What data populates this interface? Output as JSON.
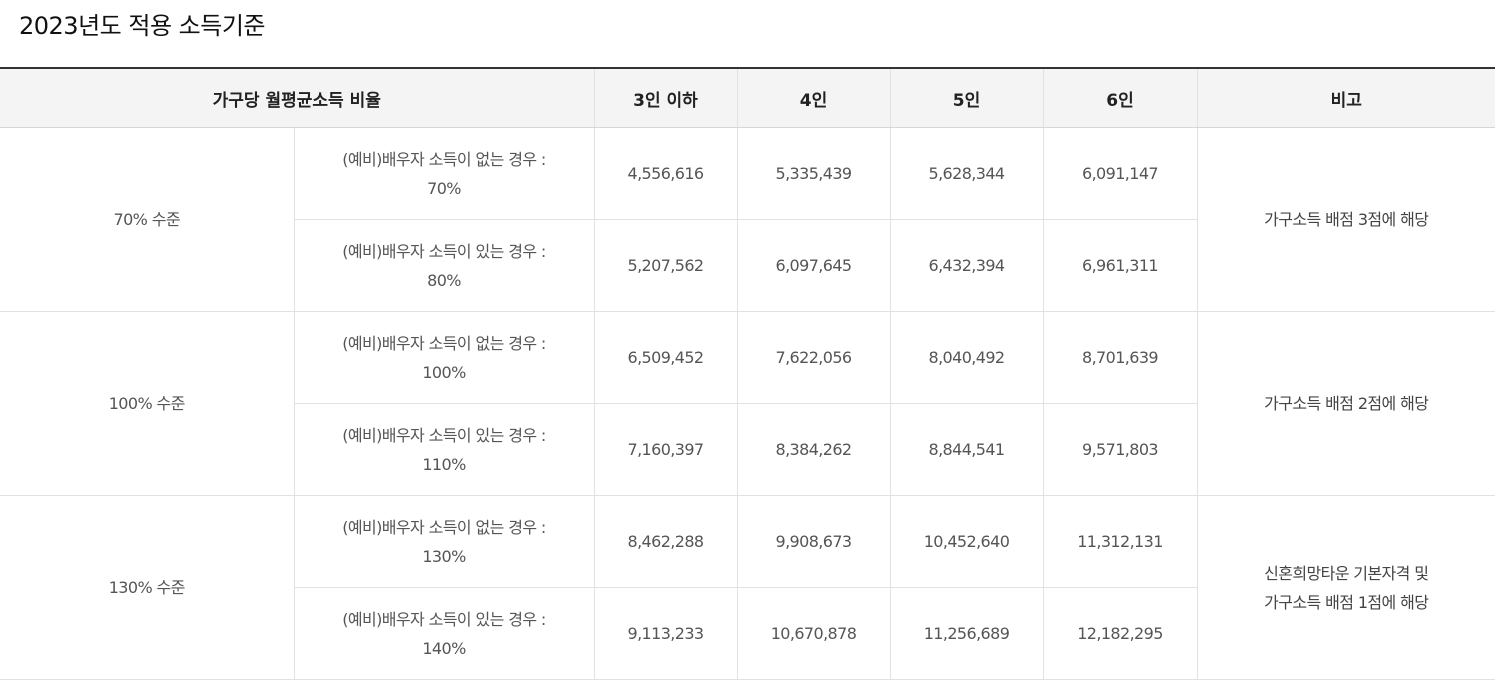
{
  "title": "2023년도 적용 소득기준",
  "table": {
    "headers": {
      "ratio": "가구당 월평균소득 비율",
      "p3": "3인 이하",
      "p4": "4인",
      "p5": "5인",
      "p6": "6인",
      "note": "비고"
    },
    "groups": [
      {
        "level": "70% 수준",
        "note_lines": [
          "가구소득 배점 3점에 해당"
        ],
        "rows": [
          {
            "case_line1": "(예비)배우자 소득이 없는 경우 :",
            "case_line2": "70%",
            "v3": "4,556,616",
            "v4": "5,335,439",
            "v5": "5,628,344",
            "v6": "6,091,147"
          },
          {
            "case_line1": "(예비)배우자 소득이 있는 경우 :",
            "case_line2": "80%",
            "v3": "5,207,562",
            "v4": "6,097,645",
            "v5": "6,432,394",
            "v6": "6,961,311"
          }
        ]
      },
      {
        "level": "100% 수준",
        "note_lines": [
          "가구소득 배점 2점에 해당"
        ],
        "rows": [
          {
            "case_line1": "(예비)배우자 소득이 없는 경우 :",
            "case_line2": "100%",
            "v3": "6,509,452",
            "v4": "7,622,056",
            "v5": "8,040,492",
            "v6": "8,701,639"
          },
          {
            "case_line1": "(예비)배우자 소득이 있는 경우 :",
            "case_line2": "110%",
            "v3": "7,160,397",
            "v4": "8,384,262",
            "v5": "8,844,541",
            "v6": "9,571,803"
          }
        ]
      },
      {
        "level": "130% 수준",
        "note_lines": [
          "신혼희망타운 기본자격 및",
          "가구소득 배점 1점에 해당"
        ],
        "rows": [
          {
            "case_line1": "(예비)배우자 소득이 없는 경우 :",
            "case_line2": "130%",
            "v3": "8,462,288",
            "v4": "9,908,673",
            "v5": "10,452,640",
            "v6": "11,312,131"
          },
          {
            "case_line1": "(예비)배우자 소득이 있는 경우 :",
            "case_line2": "140%",
            "v3": "9,113,233",
            "v4": "10,670,878",
            "v5": "11,256,689",
            "v6": "12,182,295"
          }
        ]
      }
    ]
  }
}
